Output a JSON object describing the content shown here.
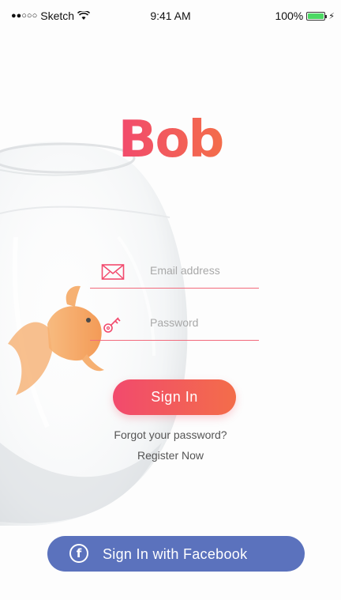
{
  "status_bar": {
    "signal": "●●○○○",
    "carrier": "Sketch",
    "time": "9:41 AM",
    "battery_percent": "100%",
    "battery_level": 1.0
  },
  "logo": {
    "text": "Bob"
  },
  "form": {
    "email_placeholder": "Email address",
    "password_placeholder": "Password",
    "accent_color": "#f24a6d"
  },
  "actions": {
    "sign_in_label": "Sign In",
    "forgot_label": "Forgot your password?",
    "register_label": "Register Now",
    "facebook_label": "Sign In with Facebook",
    "facebook_icon": "f"
  },
  "colors": {
    "primary_gradient_start": "#f24a6d",
    "primary_gradient_end": "#f36d4a",
    "facebook_blue": "#5b72bd"
  },
  "icons": {
    "email": "envelope-icon",
    "password": "key-icon",
    "facebook": "facebook-icon"
  }
}
